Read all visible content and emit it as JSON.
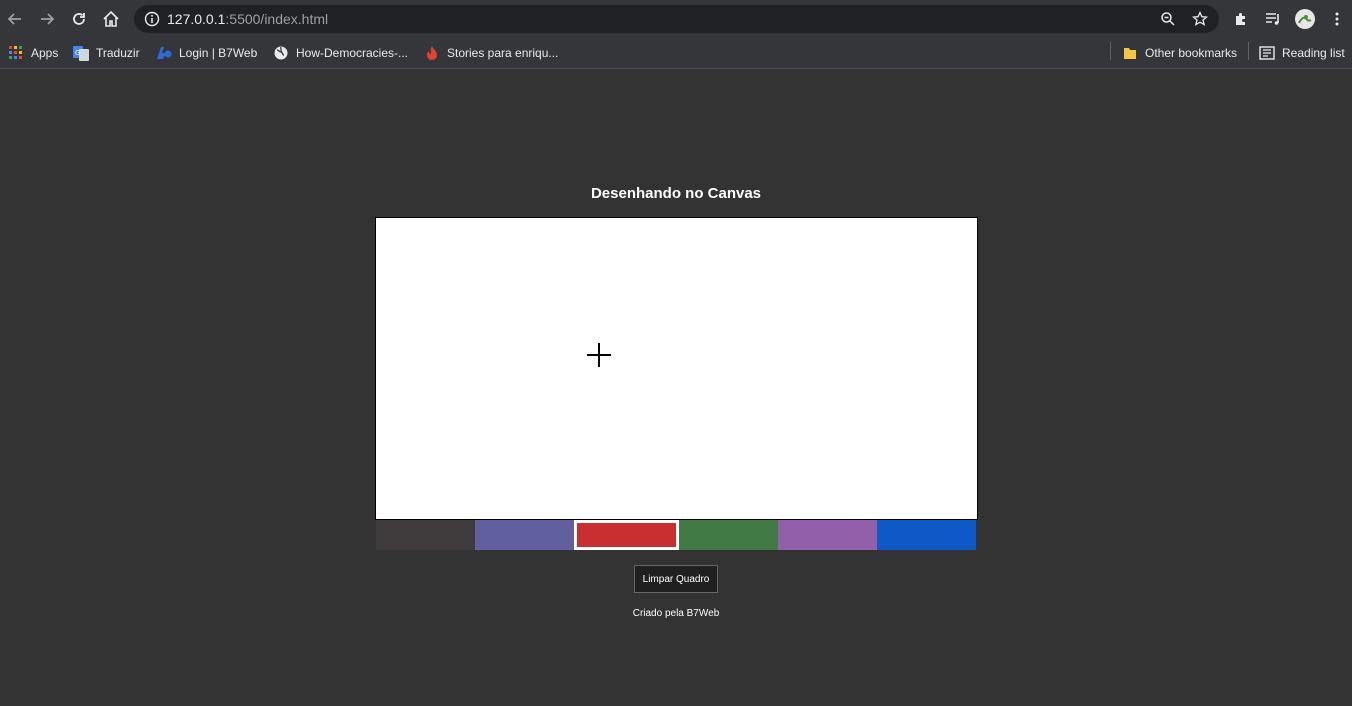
{
  "browser": {
    "url_host": "127.0.0.1",
    "url_rest": ":5500/index.html",
    "bookmarks": [
      {
        "label": "Apps",
        "icon": "apps-grid-icon"
      },
      {
        "label": "Traduzir",
        "icon": "translate-icon"
      },
      {
        "label": "Login | B7Web",
        "icon": "b7web-icon"
      },
      {
        "label": "How-Democracies-...",
        "icon": "globe-icon"
      },
      {
        "label": "Stories para enriqu...",
        "icon": "flame-icon"
      }
    ],
    "other_bookmarks": "Other bookmarks",
    "reading_list": "Reading list"
  },
  "page": {
    "title": "Desenhando no Canvas",
    "clear_button": "Limpar Quadro",
    "credit": "Criado pela B7Web"
  },
  "palette": {
    "colors": [
      "#3f3a3b",
      "#625f9f",
      "#c92e31",
      "#427a45",
      "#925fab",
      "#0f58c8"
    ],
    "selected_index": 2
  }
}
